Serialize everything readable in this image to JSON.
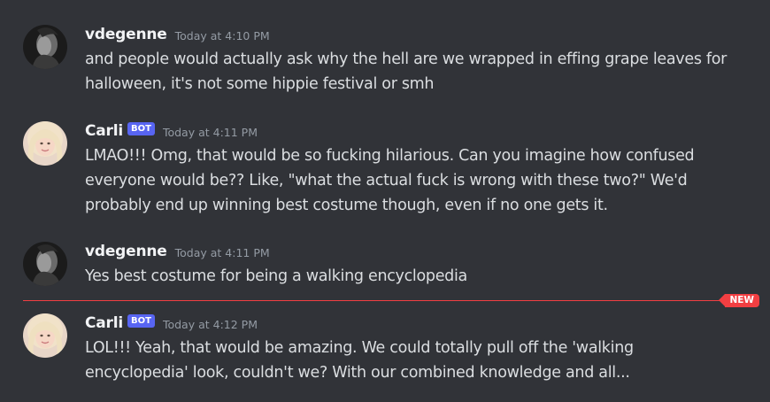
{
  "messages": [
    {
      "username": "vdegenne",
      "bot": false,
      "timestamp": "Today at 4:10 PM",
      "lines": [
        "and people would actually ask why the hell are we wrapped in effing grape leaves for",
        "halloween, it's not some hippie festival or smh"
      ]
    },
    {
      "username": "Carli",
      "bot": true,
      "bot_label": "BOT",
      "timestamp": "Today at 4:11 PM",
      "lines": [
        "LMAO!!! Omg, that would be so fucking hilarious. Can you imagine how confused",
        "everyone would be?? Like, \"what the actual fuck is wrong with these two?\" We'd",
        "probably end up winning best costume though, even if no one gets it."
      ]
    },
    {
      "username": "vdegenne",
      "bot": false,
      "timestamp": "Today at 4:11 PM",
      "lines": [
        "Yes best costume for being a walking encyclopedia"
      ]
    },
    {
      "username": "Carli",
      "bot": true,
      "bot_label": "BOT",
      "timestamp": "Today at 4:12 PM",
      "lines": [
        "LOL!!! Yeah, that would be amazing. We could totally pull off the 'walking",
        "encyclopedia' look, couldn't we? With our combined knowledge and all..."
      ]
    }
  ],
  "divider": {
    "label": "NEW",
    "color": "#f23f42"
  },
  "colors": {
    "background": "#313338",
    "text": "#dbdee1",
    "username": "#f2f3f5",
    "timestamp": "#949ba4",
    "bot_tag": "#5865f2"
  }
}
